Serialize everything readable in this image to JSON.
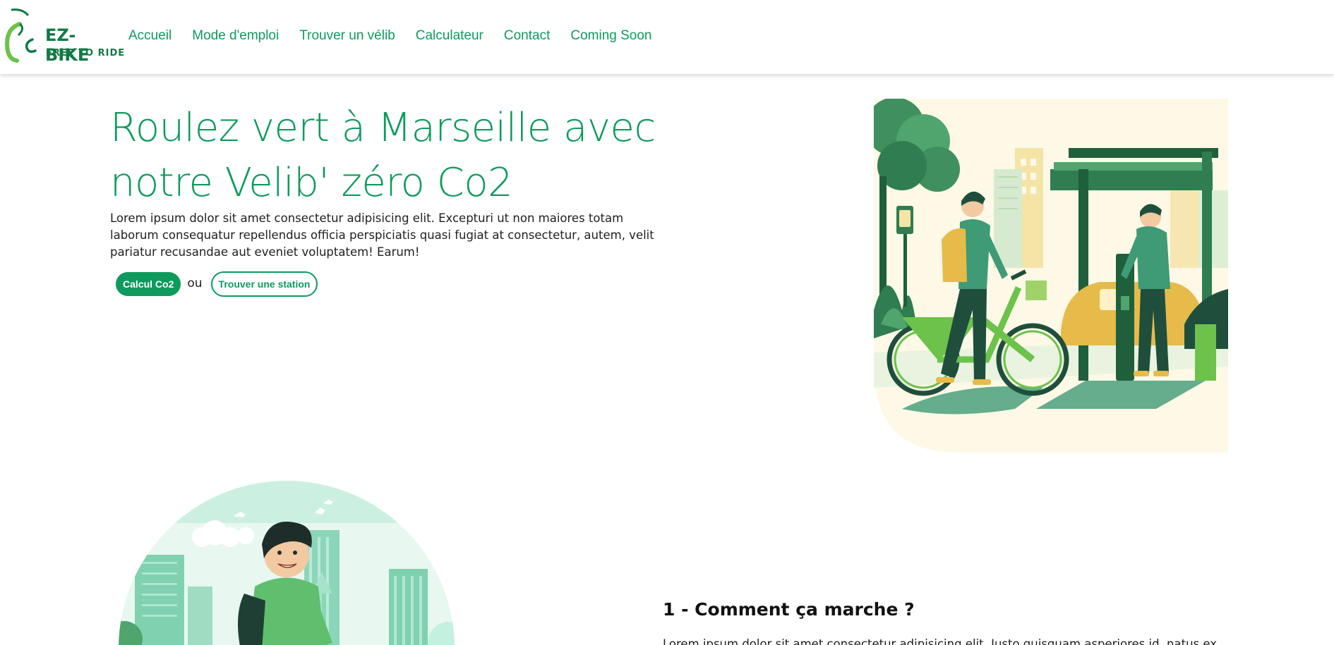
{
  "brand": {
    "title": "EZ-BIKE",
    "tagline": "FREE TO RIDE",
    "logo_icon": "bicycle-logo-icon"
  },
  "nav": {
    "items": [
      {
        "label": "Accueil"
      },
      {
        "label": "Mode d'emploi"
      },
      {
        "label": "Trouver un vélib"
      },
      {
        "label": "Calculateur"
      },
      {
        "label": "Contact"
      },
      {
        "label": "Coming Soon"
      }
    ]
  },
  "hero": {
    "title": "Roulez vert à Marseille avec notre Velib' zéro Co2",
    "text": "Lorem ipsum dolor sit amet consectetur adipisicing elit. Excepturi ut non maiores totam laborum consequatur repellendus officia perspiciatis quasi fugiat at consectetur, autem, velit pariatur recusandae aut eveniet voluptatem! Earum!",
    "primary_button": "Calcul Co2",
    "or_text": "ou",
    "secondary_button": "Trouver une station"
  },
  "section": {
    "title": "1 - Comment ça marche ?",
    "text": "Lorem ipsum dolor sit amet consectetur adipisicing elit. Iusto quisquam asperiores id, natus ex"
  },
  "colors": {
    "brand_green": "#0e9a5c",
    "dark_green": "#0f7a45",
    "light_green": "#6cc24a",
    "mint": "#a8e6d2",
    "cream": "#fdf9e6"
  }
}
